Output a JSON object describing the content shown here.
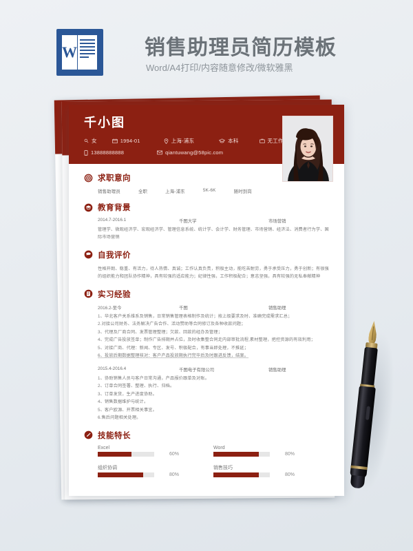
{
  "banner": {
    "title": "销售助理员简历模板",
    "subtitle": "Word/A4打印/内容随意修改/微软雅黑",
    "logo_letter": "W",
    "logo_name": "word-logo"
  },
  "resume": {
    "name": "千小图",
    "meta_line1": [
      {
        "icon": "gender-icon",
        "text": "女"
      },
      {
        "icon": "calendar-icon",
        "text": "1994-01"
      },
      {
        "icon": "location-icon",
        "text": "上海-浦东"
      },
      {
        "icon": "education-cap-icon",
        "text": "本科"
      },
      {
        "icon": "briefcase-icon",
        "text": "无工作经验"
      }
    ],
    "meta_line2": [
      {
        "icon": "phone-icon",
        "text": "13888888888"
      },
      {
        "icon": "mail-icon",
        "text": "qiantuwang@58pic.com"
      }
    ],
    "photo_alt": "candidate-photo"
  },
  "sections": {
    "objective": {
      "title": "求职意向",
      "icon": "target-icon",
      "items": [
        "销售助理员",
        "全职",
        "上海-浦东",
        "5K-6K",
        "随时到岗"
      ]
    },
    "education": {
      "title": "教育背景",
      "icon": "graduation-cap-icon",
      "period": "2014.7-2016.1",
      "school": "千图大学",
      "major": "市场营销",
      "courses": "管理学、微观经济学、宏观经济学、管理信息系统、统计学、会计学、财务管理、市场营销、经济法、消费者行为学、国际市场营销"
    },
    "self_eval": {
      "title": "自我评价",
      "icon": "chat-bubble-icon",
      "text": "性格开朗、稳重、有活力，待人热情、真诚；工作认真负责，积极主动，能吃苦耐劳，勇于承受压力，勇于创新；有很强的组织能力和团队协作精神，具有较强的适应能力；纪律性强，工作积极配合；意志坚强，具有较强的无私奉献精神"
    },
    "experience": {
      "title": "实习经验",
      "icon": "document-icon",
      "jobs": [
        {
          "period": "2016.2-至今",
          "company": "千图",
          "role": "销售助理",
          "bullets": [
            "1、华北客户关系维系及销售，日常销售管理表格制作及统计；按上级要求及时、准确完成需求汇总；",
            "2.对接公司财务、法务解决广告合作、活动赞助等合同修订及各种收款问题；",
            "3、代理及厂商合同、发票管理整理；欠款、回款的经办及管理；",
            "4、完成广告投放签单；制作广告排期并占位，及时收集整合同走内部审批流程,素材整理，把控资源的有效利用；",
            "5、对接广商、代理：新闻、专区、发号、积极配合，有事当即处理，不推延；",
            "6、投放后期数据整理核对：客户产品投放期执行完毕后及时跟进反馈，结案。"
          ]
        },
        {
          "period": "2015.4-2016.4",
          "company": "千图电子有限公司",
          "role": "销售助理",
          "bullets": [
            "1、协助销售人员与客户日常沟通，产品报价跟单及对账。",
            "2、订单合同签署、整理、执行、归档。",
            "3、订单发货，生产进度协助。",
            "4、销售数据维护与统计。",
            "5、客户欧源、开票相关事宜。",
            "6.售后问题相关处理。"
          ]
        }
      ]
    },
    "skills": {
      "title": "技能特长",
      "icon": "pen-badge-icon",
      "items": [
        {
          "label": "Excel",
          "percent": "60%",
          "value": 60
        },
        {
          "label": "Word",
          "percent": "80%",
          "value": 80
        },
        {
          "label": "组织协调",
          "percent": "80%",
          "value": 80
        },
        {
          "label": "销售技巧",
          "percent": "80%",
          "value": 80
        }
      ]
    }
  },
  "decor": {
    "pen_name": "fountain-pen"
  },
  "colors": {
    "brand_red": "#8c2012",
    "word_blue": "#2b5797",
    "page_bg": "#eef1f4"
  }
}
